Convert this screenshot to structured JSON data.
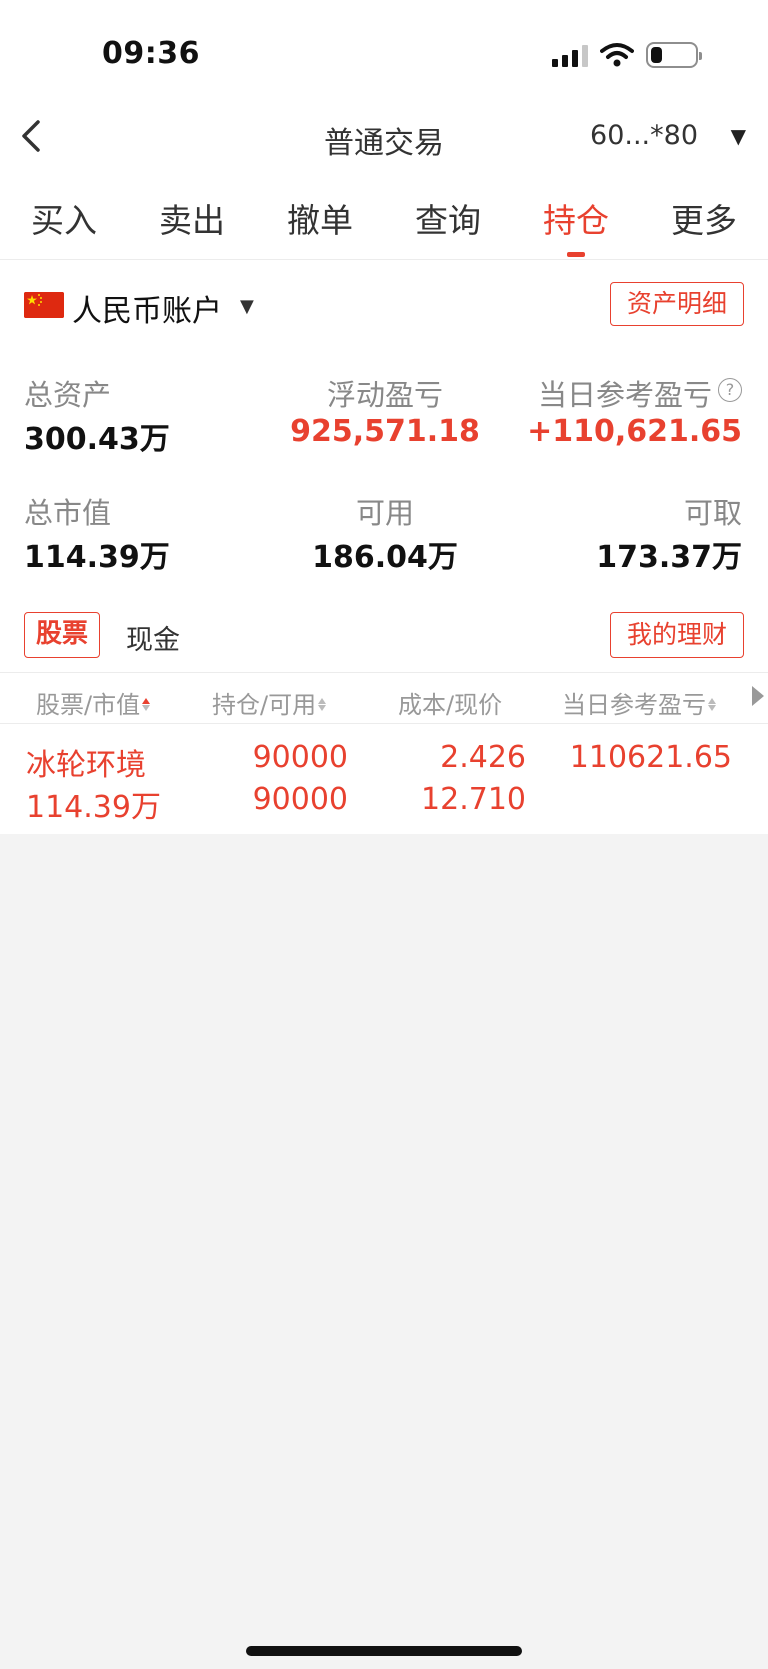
{
  "status_bar": {
    "time": "09:36",
    "battery_level": 0.25
  },
  "nav": {
    "back_icon": "chevron-left-icon",
    "title": "普通交易",
    "account": "60...*80",
    "dropdown_caret": "▼"
  },
  "tabs": [
    {
      "label": "买入",
      "active": false
    },
    {
      "label": "卖出",
      "active": false
    },
    {
      "label": "撤单",
      "active": false
    },
    {
      "label": "查询",
      "active": false
    },
    {
      "label": "持仓",
      "active": true
    },
    {
      "label": "更多",
      "active": false
    }
  ],
  "account": {
    "flag_icon": "china-flag-icon",
    "label": "人民币账户",
    "caret": "▼",
    "detail_button": "资产明细"
  },
  "summary": {
    "total_assets_label": "总资产",
    "total_assets": "300.43万",
    "floating_pnl_label": "浮动盈亏",
    "floating_pnl": "925,571.18",
    "daily_pnl_label": "当日参考盈亏",
    "daily_pnl": "+110,621.65",
    "help_glyph": "?",
    "market_value_label": "总市值",
    "market_value": "114.39万",
    "available_label": "可用",
    "available": "186.04万",
    "withdrawable_label": "可取",
    "withdrawable": "173.37万"
  },
  "segments": {
    "stock": "股票",
    "cash": "现金",
    "finance_button": "我的理财"
  },
  "table": {
    "headers": [
      "股票/市值",
      "持仓/可用",
      "成本/现价",
      "当日参考盈亏"
    ],
    "rows": [
      {
        "name": "冰轮环境",
        "market_value": "114.39万",
        "position": "90000",
        "available": "90000",
        "cost": "2.426",
        "price": "12.710",
        "daily_pnl": "110621.65"
      }
    ]
  },
  "colors": {
    "accent_red": "#e8412f",
    "text_primary": "#111111",
    "text_secondary": "#888888",
    "background": "#f3f3f3"
  }
}
